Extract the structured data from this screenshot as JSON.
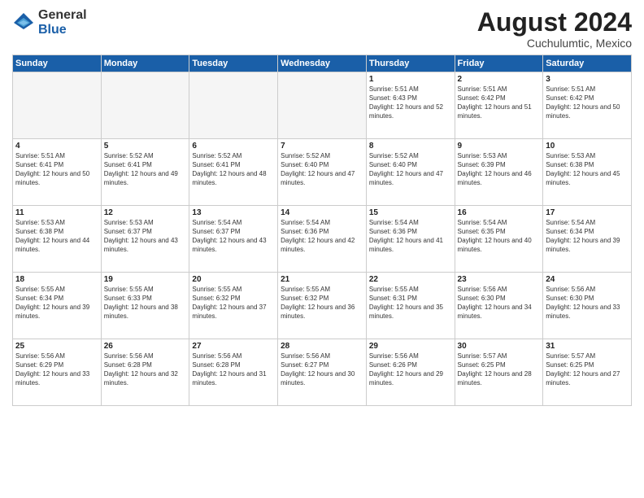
{
  "logo": {
    "general": "General",
    "blue": "Blue"
  },
  "header": {
    "month_year": "August 2024",
    "location": "Cuchulumtic, Mexico"
  },
  "weekdays": [
    "Sunday",
    "Monday",
    "Tuesday",
    "Wednesday",
    "Thursday",
    "Friday",
    "Saturday"
  ],
  "weeks": [
    [
      {
        "day": "",
        "empty": true
      },
      {
        "day": "",
        "empty": true
      },
      {
        "day": "",
        "empty": true
      },
      {
        "day": "",
        "empty": true
      },
      {
        "day": "1",
        "sunrise": "5:51 AM",
        "sunset": "6:43 PM",
        "daylight": "12 hours and 52 minutes."
      },
      {
        "day": "2",
        "sunrise": "5:51 AM",
        "sunset": "6:42 PM",
        "daylight": "12 hours and 51 minutes."
      },
      {
        "day": "3",
        "sunrise": "5:51 AM",
        "sunset": "6:42 PM",
        "daylight": "12 hours and 50 minutes."
      }
    ],
    [
      {
        "day": "4",
        "sunrise": "5:51 AM",
        "sunset": "6:41 PM",
        "daylight": "12 hours and 50 minutes."
      },
      {
        "day": "5",
        "sunrise": "5:52 AM",
        "sunset": "6:41 PM",
        "daylight": "12 hours and 49 minutes."
      },
      {
        "day": "6",
        "sunrise": "5:52 AM",
        "sunset": "6:41 PM",
        "daylight": "12 hours and 48 minutes."
      },
      {
        "day": "7",
        "sunrise": "5:52 AM",
        "sunset": "6:40 PM",
        "daylight": "12 hours and 47 minutes."
      },
      {
        "day": "8",
        "sunrise": "5:52 AM",
        "sunset": "6:40 PM",
        "daylight": "12 hours and 47 minutes."
      },
      {
        "day": "9",
        "sunrise": "5:53 AM",
        "sunset": "6:39 PM",
        "daylight": "12 hours and 46 minutes."
      },
      {
        "day": "10",
        "sunrise": "5:53 AM",
        "sunset": "6:38 PM",
        "daylight": "12 hours and 45 minutes."
      }
    ],
    [
      {
        "day": "11",
        "sunrise": "5:53 AM",
        "sunset": "6:38 PM",
        "daylight": "12 hours and 44 minutes."
      },
      {
        "day": "12",
        "sunrise": "5:53 AM",
        "sunset": "6:37 PM",
        "daylight": "12 hours and 43 minutes."
      },
      {
        "day": "13",
        "sunrise": "5:54 AM",
        "sunset": "6:37 PM",
        "daylight": "12 hours and 43 minutes."
      },
      {
        "day": "14",
        "sunrise": "5:54 AM",
        "sunset": "6:36 PM",
        "daylight": "12 hours and 42 minutes."
      },
      {
        "day": "15",
        "sunrise": "5:54 AM",
        "sunset": "6:36 PM",
        "daylight": "12 hours and 41 minutes."
      },
      {
        "day": "16",
        "sunrise": "5:54 AM",
        "sunset": "6:35 PM",
        "daylight": "12 hours and 40 minutes."
      },
      {
        "day": "17",
        "sunrise": "5:54 AM",
        "sunset": "6:34 PM",
        "daylight": "12 hours and 39 minutes."
      }
    ],
    [
      {
        "day": "18",
        "sunrise": "5:55 AM",
        "sunset": "6:34 PM",
        "daylight": "12 hours and 39 minutes."
      },
      {
        "day": "19",
        "sunrise": "5:55 AM",
        "sunset": "6:33 PM",
        "daylight": "12 hours and 38 minutes."
      },
      {
        "day": "20",
        "sunrise": "5:55 AM",
        "sunset": "6:32 PM",
        "daylight": "12 hours and 37 minutes."
      },
      {
        "day": "21",
        "sunrise": "5:55 AM",
        "sunset": "6:32 PM",
        "daylight": "12 hours and 36 minutes."
      },
      {
        "day": "22",
        "sunrise": "5:55 AM",
        "sunset": "6:31 PM",
        "daylight": "12 hours and 35 minutes."
      },
      {
        "day": "23",
        "sunrise": "5:56 AM",
        "sunset": "6:30 PM",
        "daylight": "12 hours and 34 minutes."
      },
      {
        "day": "24",
        "sunrise": "5:56 AM",
        "sunset": "6:30 PM",
        "daylight": "12 hours and 33 minutes."
      }
    ],
    [
      {
        "day": "25",
        "sunrise": "5:56 AM",
        "sunset": "6:29 PM",
        "daylight": "12 hours and 33 minutes."
      },
      {
        "day": "26",
        "sunrise": "5:56 AM",
        "sunset": "6:28 PM",
        "daylight": "12 hours and 32 minutes."
      },
      {
        "day": "27",
        "sunrise": "5:56 AM",
        "sunset": "6:28 PM",
        "daylight": "12 hours and 31 minutes."
      },
      {
        "day": "28",
        "sunrise": "5:56 AM",
        "sunset": "6:27 PM",
        "daylight": "12 hours and 30 minutes."
      },
      {
        "day": "29",
        "sunrise": "5:56 AM",
        "sunset": "6:26 PM",
        "daylight": "12 hours and 29 minutes."
      },
      {
        "day": "30",
        "sunrise": "5:57 AM",
        "sunset": "6:25 PM",
        "daylight": "12 hours and 28 minutes."
      },
      {
        "day": "31",
        "sunrise": "5:57 AM",
        "sunset": "6:25 PM",
        "daylight": "12 hours and 27 minutes."
      }
    ]
  ]
}
